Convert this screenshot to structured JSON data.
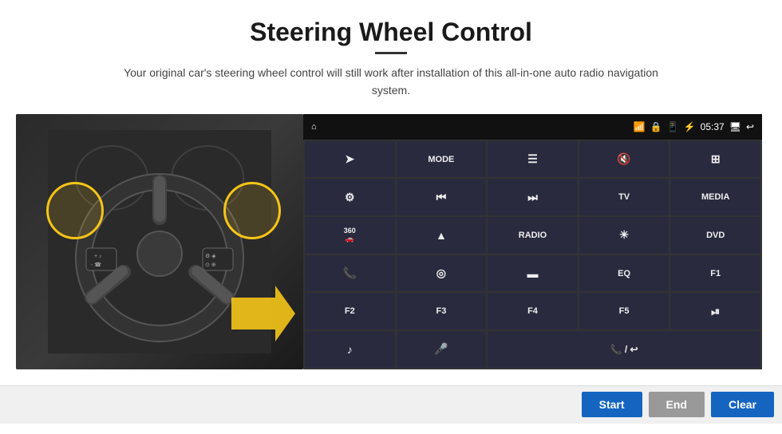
{
  "header": {
    "title": "Steering Wheel Control",
    "subtitle": "Your original car's steering wheel control will still work after installation of this all-in-one auto radio navigation system."
  },
  "status_bar": {
    "time": "05:37",
    "icons": [
      "home",
      "wifi",
      "lock",
      "sim",
      "bluetooth",
      "monitor",
      "back"
    ]
  },
  "grid_buttons": [
    {
      "id": "b1",
      "icon": "➤",
      "label": "",
      "span": 1
    },
    {
      "id": "b2",
      "icon": "",
      "label": "MODE",
      "span": 1
    },
    {
      "id": "b3",
      "icon": "≡",
      "label": "",
      "span": 1
    },
    {
      "id": "b4",
      "icon": "🔇",
      "label": "",
      "span": 1
    },
    {
      "id": "b5",
      "icon": "⊞",
      "label": "",
      "span": 1
    },
    {
      "id": "b6",
      "icon": "⚙",
      "label": "",
      "span": 1
    },
    {
      "id": "b7",
      "icon": "⏮",
      "label": "",
      "span": 1
    },
    {
      "id": "b8",
      "icon": "⏭",
      "label": "",
      "span": 1
    },
    {
      "id": "b9",
      "icon": "",
      "label": "TV",
      "span": 1
    },
    {
      "id": "b10",
      "icon": "",
      "label": "MEDIA",
      "span": 1
    },
    {
      "id": "b11",
      "icon": "360",
      "label": "",
      "span": 1
    },
    {
      "id": "b12",
      "icon": "▲",
      "label": "",
      "span": 1
    },
    {
      "id": "b13",
      "icon": "",
      "label": "RADIO",
      "span": 1
    },
    {
      "id": "b14",
      "icon": "☀",
      "label": "",
      "span": 1
    },
    {
      "id": "b15",
      "icon": "",
      "label": "DVD",
      "span": 1
    },
    {
      "id": "b16",
      "icon": "📞",
      "label": "",
      "span": 1
    },
    {
      "id": "b17",
      "icon": "◎",
      "label": "",
      "span": 1
    },
    {
      "id": "b18",
      "icon": "▬",
      "label": "",
      "span": 1
    },
    {
      "id": "b19",
      "icon": "",
      "label": "EQ",
      "span": 1
    },
    {
      "id": "b20",
      "icon": "",
      "label": "F1",
      "span": 1
    },
    {
      "id": "b21",
      "icon": "",
      "label": "F2",
      "span": 1
    },
    {
      "id": "b22",
      "icon": "",
      "label": "F3",
      "span": 1
    },
    {
      "id": "b23",
      "icon": "",
      "label": "F4",
      "span": 1
    },
    {
      "id": "b24",
      "icon": "",
      "label": "F5",
      "span": 1
    },
    {
      "id": "b25",
      "icon": "⏯",
      "label": "",
      "span": 1
    },
    {
      "id": "b26",
      "icon": "♪",
      "label": "",
      "span": 1
    },
    {
      "id": "b27",
      "icon": "🎤",
      "label": "",
      "span": 1
    },
    {
      "id": "b28",
      "icon": "📞/",
      "label": "",
      "span": 1
    }
  ],
  "bottom_buttons": {
    "start": "Start",
    "end": "End",
    "clear": "Clear"
  }
}
